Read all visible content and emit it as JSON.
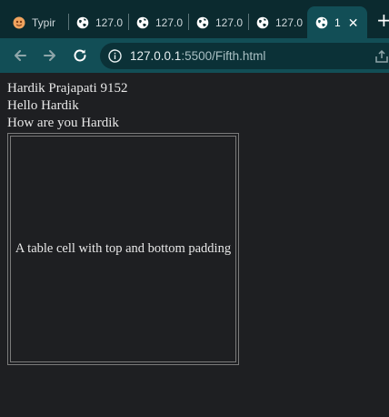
{
  "tabs": [
    {
      "title": "Typir",
      "icon": "typing-favicon"
    },
    {
      "title": "127.0",
      "icon": "globe-icon"
    },
    {
      "title": "127.0",
      "icon": "globe-icon"
    },
    {
      "title": "127.0",
      "icon": "globe-icon"
    },
    {
      "title": "127.0",
      "icon": "globe-icon"
    },
    {
      "title": "1",
      "icon": "globe-icon",
      "active": true,
      "close": "✕"
    }
  ],
  "new_tab": "+",
  "toolbar": {
    "back": "back-arrow-icon",
    "forward": "forward-arrow-icon",
    "reload": "reload-icon"
  },
  "address": {
    "host": "127.0.0.1",
    "rest": ":5500/Fifth.html"
  },
  "page": {
    "lines": [
      "Hardik Prajapati 9152",
      "Hello Hardik",
      "How are you Hardik"
    ],
    "table_cell": "A table cell with top and bottom padding"
  },
  "colors": {
    "tabstrip": "#0b2a2f",
    "toolbar": "#124e56",
    "page_bg": "#1e1f22",
    "text": "#e8e8e8"
  }
}
